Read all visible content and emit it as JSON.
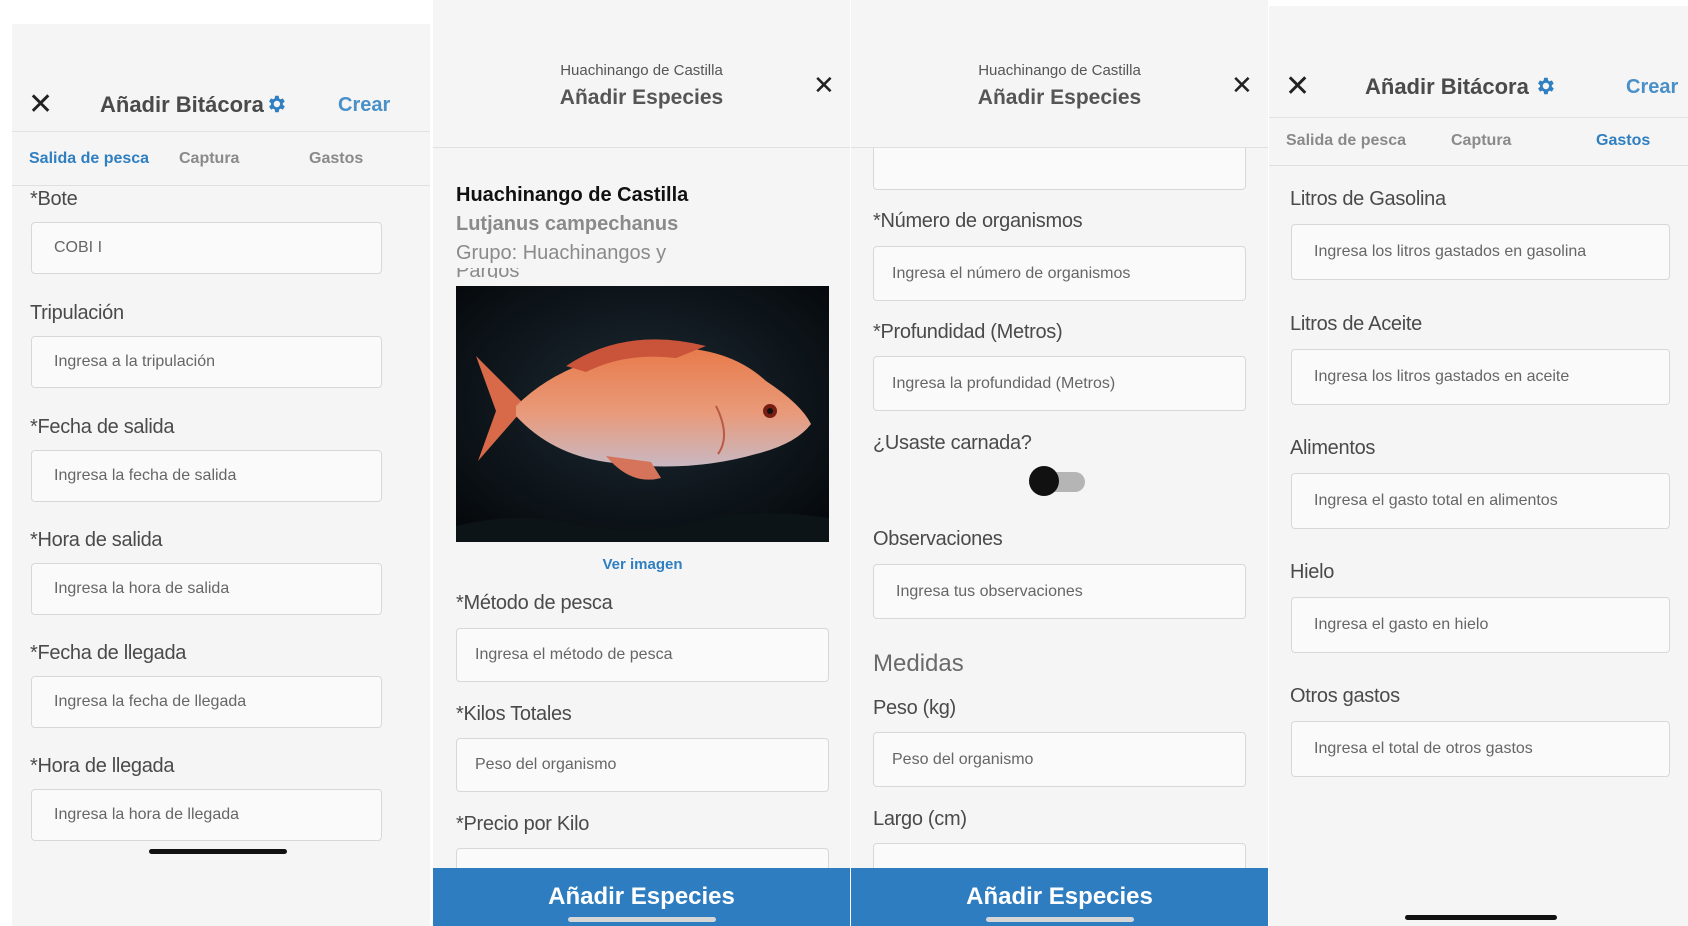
{
  "screen1": {
    "header": {
      "close": "✕",
      "title": "Añadir Bitácora",
      "action": "Crear"
    },
    "tabs": [
      "Salida de pesca",
      "Captura",
      "Gastos"
    ],
    "fields": [
      {
        "label": "*Bote",
        "value": "COBI I"
      },
      {
        "label": "Tripulación",
        "placeholder": "Ingresa a la tripulación"
      },
      {
        "label": "*Fecha de salida",
        "placeholder": "Ingresa la fecha de salida"
      },
      {
        "label": "*Hora de salida",
        "placeholder": "Ingresa la hora de salida"
      },
      {
        "label": "*Fecha de llegada",
        "placeholder": "Ingresa la fecha de llegada"
      },
      {
        "label": "*Hora de llegada",
        "placeholder": "Ingresa la hora de llegada"
      }
    ]
  },
  "screen2": {
    "header": {
      "subtitle": "Huachinango de Castilla",
      "title": "Añadir Especies",
      "close": "✕"
    },
    "species": {
      "common_name": "Huachinango de Castilla",
      "scientific_name": "Lutjanus campechanus",
      "group": "Grupo: Huachinangos y",
      "group_cut": "Pargos"
    },
    "image_link": "Ver imagen",
    "fields": [
      {
        "label": "*Método de pesca",
        "placeholder": "Ingresa el método de pesca"
      },
      {
        "label": "*Kilos Totales",
        "placeholder": "Peso del organismo"
      },
      {
        "label": "*Precio por Kilo",
        "placeholder": ""
      }
    ],
    "bottom_button": "Añadir Especies"
  },
  "screen3": {
    "header": {
      "subtitle": "Huachinango de Castilla",
      "title": "Añadir Especies",
      "close": "✕"
    },
    "fields_top": [
      {
        "label": "*Número de organismos",
        "placeholder": "Ingresa el número de organismos"
      },
      {
        "label": "*Profundidad (Metros)",
        "placeholder": "Ingresa la profundidad (Metros)"
      }
    ],
    "bait_question": "¿Usaste carnada?",
    "bait_toggle": false,
    "observations": {
      "label": "Observaciones",
      "placeholder": "Ingresa tus observaciones"
    },
    "section_title": "Medidas",
    "weight": {
      "label": "Peso (kg)",
      "placeholder": "Peso del organismo"
    },
    "length": {
      "label": "Largo (cm)"
    },
    "bottom_button": "Añadir Especies"
  },
  "screen4": {
    "header": {
      "close": "✕",
      "title": "Añadir Bitácora",
      "action": "Crear"
    },
    "tabs": [
      "Salida de pesca",
      "Captura",
      "Gastos"
    ],
    "fields": [
      {
        "label": "Litros de Gasolina",
        "placeholder": "Ingresa los litros gastados en gasolina"
      },
      {
        "label": "Litros de Aceite",
        "placeholder": "Ingresa los litros gastados en aceite"
      },
      {
        "label": "Alimentos",
        "placeholder": "Ingresa el gasto total en alimentos"
      },
      {
        "label": "Hielo",
        "placeholder": "Ingresa el gasto en hielo"
      },
      {
        "label": "Otros gastos",
        "placeholder": "Ingresa el total de otros gastos"
      }
    ]
  },
  "colors": {
    "accent": "#2f7fc1",
    "button": "#2d7dc0",
    "crear": "#4a90c8"
  }
}
